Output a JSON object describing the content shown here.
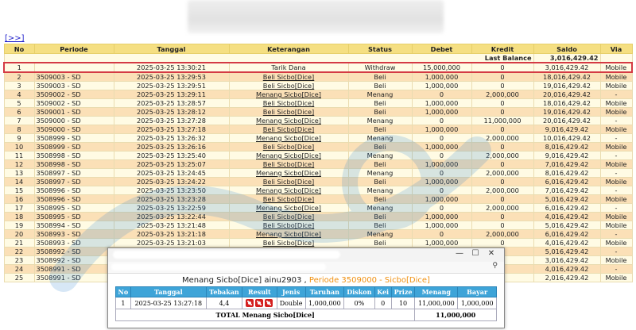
{
  "nav": {
    "link": "[>>]"
  },
  "table": {
    "headers": [
      "No",
      "Periode",
      "Tanggal",
      "Keterangan",
      "Status",
      "Debet",
      "Kredit",
      "Saldo",
      "Via"
    ],
    "last_balance_label": "Last Balance",
    "last_balance_value": "3,016,429.42",
    "rows": [
      {
        "no": "1",
        "periode": "",
        "tanggal": "2025-03-25 13:30:21",
        "ket": "Tarik Dana",
        "status": "Withdraw",
        "debet": "15,000,000",
        "kredit": "0",
        "saldo": "3,016,429.42",
        "via": "Mobile"
      },
      {
        "no": "2",
        "periode": "3509003 - SD",
        "tanggal": "2025-03-25 13:29:53",
        "ket": "Beli Sicbo[Dice]",
        "status": "Beli",
        "debet": "1,000,000",
        "kredit": "0",
        "saldo": "18,016,429.42",
        "via": "Mobile"
      },
      {
        "no": "3",
        "periode": "3509003 - SD",
        "tanggal": "2025-03-25 13:29:51",
        "ket": "Beli Sicbo[Dice]",
        "status": "Beli",
        "debet": "1,000,000",
        "kredit": "0",
        "saldo": "19,016,429.42",
        "via": "Mobile"
      },
      {
        "no": "4",
        "periode": "3509002 - SD",
        "tanggal": "2025-03-25 13:29:11",
        "ket": "Menang Sicbo[Dice]",
        "status": "Menang",
        "debet": "0",
        "kredit": "2,000,000",
        "saldo": "20,016,429.42",
        "via": "-"
      },
      {
        "no": "5",
        "periode": "3509002 - SD",
        "tanggal": "2025-03-25 13:28:57",
        "ket": "Beli Sicbo[Dice]",
        "status": "Beli",
        "debet": "1,000,000",
        "kredit": "0",
        "saldo": "18,016,429.42",
        "via": "Mobile"
      },
      {
        "no": "6",
        "periode": "3509001 - SD",
        "tanggal": "2025-03-25 13:28:12",
        "ket": "Beli Sicbo[Dice]",
        "status": "Beli",
        "debet": "1,000,000",
        "kredit": "0",
        "saldo": "19,016,429.42",
        "via": "Mobile"
      },
      {
        "no": "7",
        "periode": "3509000 - SD",
        "tanggal": "2025-03-25 13:27:28",
        "ket": "Menang Sicbo[Dice]",
        "status": "Menang",
        "debet": "0",
        "kredit": "11,000,000",
        "saldo": "20,016,429.42",
        "via": "-"
      },
      {
        "no": "8",
        "periode": "3509000 - SD",
        "tanggal": "2025-03-25 13:27:18",
        "ket": "Beli Sicbo[Dice]",
        "status": "Beli",
        "debet": "1,000,000",
        "kredit": "0",
        "saldo": "9,016,429.42",
        "via": "Mobile"
      },
      {
        "no": "9",
        "periode": "3508999 - SD",
        "tanggal": "2025-03-25 13:26:32",
        "ket": "Menang Sicbo[Dice]",
        "status": "Menang",
        "debet": "0",
        "kredit": "2,000,000",
        "saldo": "10,016,429.42",
        "via": "-"
      },
      {
        "no": "10",
        "periode": "3508999 - SD",
        "tanggal": "2025-03-25 13:26:16",
        "ket": "Beli Sicbo[Dice]",
        "status": "Beli",
        "debet": "1,000,000",
        "kredit": "0",
        "saldo": "8,016,429.42",
        "via": "Mobile"
      },
      {
        "no": "11",
        "periode": "3508998 - SD",
        "tanggal": "2025-03-25 13:25:40",
        "ket": "Menang Sicbo[Dice]",
        "status": "Menang",
        "debet": "0",
        "kredit": "2,000,000",
        "saldo": "9,016,429.42",
        "via": "-"
      },
      {
        "no": "12",
        "periode": "3508998 - SD",
        "tanggal": "2025-03-25 13:25:07",
        "ket": "Beli Sicbo[Dice]",
        "status": "Beli",
        "debet": "1,000,000",
        "kredit": "0",
        "saldo": "7,016,429.42",
        "via": "Mobile"
      },
      {
        "no": "13",
        "periode": "3508997 - SD",
        "tanggal": "2025-03-25 13:24:45",
        "ket": "Menang Sicbo[Dice]",
        "status": "Menang",
        "debet": "0",
        "kredit": "2,000,000",
        "saldo": "8,016,429.42",
        "via": "-"
      },
      {
        "no": "14",
        "periode": "3508997 - SD",
        "tanggal": "2025-03-25 13:24:22",
        "ket": "Beli Sicbo[Dice]",
        "status": "Beli",
        "debet": "1,000,000",
        "kredit": "0",
        "saldo": "6,016,429.42",
        "via": "Mobile"
      },
      {
        "no": "15",
        "periode": "3508996 - SD",
        "tanggal": "2025-03-25 13:23:50",
        "ket": "Menang Sicbo[Dice]",
        "status": "Menang",
        "debet": "0",
        "kredit": "2,000,000",
        "saldo": "7,016,429.42",
        "via": "-"
      },
      {
        "no": "16",
        "periode": "3508996 - SD",
        "tanggal": "2025-03-25 13:23:28",
        "ket": "Beli Sicbo[Dice]",
        "status": "Beli",
        "debet": "1,000,000",
        "kredit": "0",
        "saldo": "5,016,429.42",
        "via": "Mobile"
      },
      {
        "no": "17",
        "periode": "3508995 - SD",
        "tanggal": "2025-03-25 13:22:59",
        "ket": "Menang Sicbo[Dice]",
        "status": "Menang",
        "debet": "0",
        "kredit": "2,000,000",
        "saldo": "6,016,429.42",
        "via": "-"
      },
      {
        "no": "18",
        "periode": "3508995 - SD",
        "tanggal": "2025-03-25 13:22:44",
        "ket": "Beli Sicbo[Dice]",
        "status": "Beli",
        "debet": "1,000,000",
        "kredit": "0",
        "saldo": "4,016,429.42",
        "via": "Mobile"
      },
      {
        "no": "19",
        "periode": "3508994 - SD",
        "tanggal": "2025-03-25 13:21:48",
        "ket": "Beli Sicbo[Dice]",
        "status": "Beli",
        "debet": "1,000,000",
        "kredit": "0",
        "saldo": "5,016,429.42",
        "via": "Mobile"
      },
      {
        "no": "20",
        "periode": "3508993 - SD",
        "tanggal": "2025-03-25 13:21:18",
        "ket": "Menang Sicbo[Dice]",
        "status": "Menang",
        "debet": "0",
        "kredit": "2,000,000",
        "saldo": "6,016,429.42",
        "via": "-"
      },
      {
        "no": "21",
        "periode": "3508993 - SD",
        "tanggal": "2025-03-25 13:21:03",
        "ket": "Beli Sicbo[Dice]",
        "status": "Beli",
        "debet": "1,000,000",
        "kredit": "0",
        "saldo": "4,016,429.42",
        "via": "Mobile"
      },
      {
        "no": "22",
        "periode": "3508992 - SD",
        "tanggal": "",
        "ket": "",
        "status": "",
        "debet": "",
        "kredit": "",
        "saldo": "5,016,429.42",
        "via": "-"
      },
      {
        "no": "23",
        "periode": "3508992 - SD",
        "tanggal": "",
        "ket": "",
        "status": "",
        "debet": "",
        "kredit": "",
        "saldo": "3,016,429.42",
        "via": "Mobile"
      },
      {
        "no": "24",
        "periode": "3508991 - SD",
        "tanggal": "",
        "ket": "",
        "status": "",
        "debet": "",
        "kredit": "",
        "saldo": "4,016,429.42",
        "via": "-"
      },
      {
        "no": "25",
        "periode": "3508991 - SD",
        "tanggal": "",
        "ket": "",
        "status": "",
        "debet": "",
        "kredit": "",
        "saldo": "2,016,429.42",
        "via": "Mobile"
      }
    ]
  },
  "popup": {
    "zoom_icon": "search-icon",
    "heading_main": "Menang Sicbo[Dice] ainu2903 ,",
    "heading_period": "Periode 3509000 - Sicbo[Dice]",
    "headers": [
      "No",
      "Tanggal",
      "Tebakan",
      "Result",
      "Jenis",
      "Taruhan",
      "Diskon",
      "Kei",
      "Prize",
      "Menang",
      "Bayar"
    ],
    "row": {
      "no": "1",
      "tanggal": "2025-03-25 13:27:18",
      "tebakan": "4,4",
      "jenis": "Double",
      "taruhan": "1,000,000",
      "diskon": "0%",
      "kei": "0",
      "prize": "10",
      "menang": "11,000,000",
      "bayar": "1,000,000"
    },
    "total_label": "TOTAL  Menang Sicbo[Dice]",
    "total_value": "11,000,000"
  },
  "colors": {
    "header_bg": "#f5df82",
    "row_even": "#fbe0b7",
    "row_odd": "#fffbe4",
    "highlight": "#d43a44",
    "popup_header": "#3ea4d8"
  }
}
